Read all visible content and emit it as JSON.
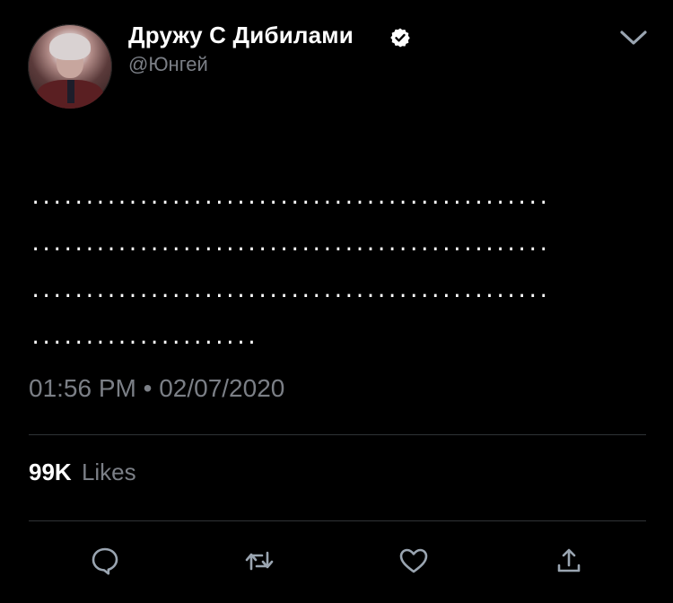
{
  "user": {
    "display_name": "Дружу С Дибилами",
    "handle": "@Юнгей",
    "verified": true
  },
  "tweet": {
    "text": "................................................\n................................................\n................................................\n....................."
  },
  "meta": {
    "timestamp": "01:56 PM • 02/07/2020",
    "likes_count": "99K",
    "likes_label": "Likes"
  },
  "icons": {
    "verified": "verified-badge-icon",
    "more": "chevron-down-icon",
    "reply": "reply-icon",
    "retweet": "retweet-icon",
    "like": "heart-icon",
    "share": "share-icon"
  },
  "colors": {
    "background": "#000000",
    "primary_text": "#ffffff",
    "secondary_text": "#7b7f86",
    "divider": "#2f3336",
    "icon": "#9aa5b1"
  }
}
